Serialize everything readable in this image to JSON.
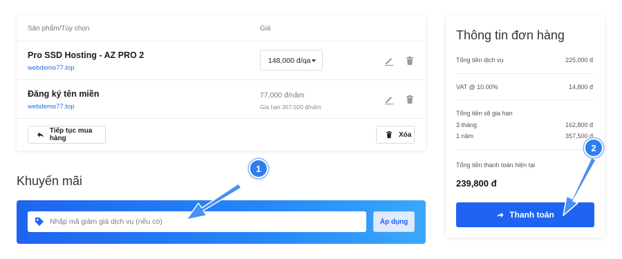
{
  "cart": {
    "header": {
      "product_col": "Sản phẩm/Tùy chọn",
      "price_col": "Giá"
    },
    "items": [
      {
        "title": "Pro SSD Hosting - AZ PRO 2",
        "domain": "webdemo77.top",
        "cycle_value": "148,000 đ/qa"
      },
      {
        "title": "Đăng ký tên miền",
        "domain": "webdemo77.top",
        "price": "77,000 đ/năm",
        "renewal": "Gia hạn 357,500 đ/năm"
      }
    ],
    "continue_label": "Tiếp tục mua hàng",
    "clear_label": "Xóa"
  },
  "promo": {
    "title": "Khuyến mãi",
    "placeholder": "Nhập mã giảm giá dịch vụ (nếu có)",
    "apply_label": "Áp dụng"
  },
  "summary": {
    "title": "Thông tin đơn hàng",
    "subtotal_label": "Tổng tiền dịch vụ",
    "subtotal_value": "225,000 đ",
    "vat_label": "VAT @ 10.00%",
    "vat_value": "14,800 đ",
    "renewal_label": "Tổng tiền sẽ gia hạn",
    "renewals": [
      {
        "period": "3 tháng",
        "amount": "162,800 đ"
      },
      {
        "period": "1 năm",
        "amount": "357,500 đ"
      }
    ],
    "due_label": "Tổng tiền thanh toán hiện tại",
    "due_value": "239,800 đ",
    "checkout_label": "Thanh toán"
  },
  "annotations": {
    "step1": "1",
    "step2": "2"
  },
  "colors": {
    "primary": "#1f64f0",
    "link": "#1a6de8",
    "badge": "#2f7df0",
    "arrow": "#4a8ff2"
  }
}
